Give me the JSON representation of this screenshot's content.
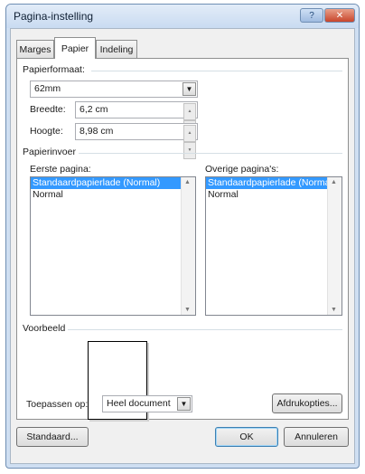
{
  "window": {
    "title": "Pagina-instelling",
    "help_label": "?",
    "close_label": "✕"
  },
  "tabs": [
    {
      "label": "Marges",
      "active": false
    },
    {
      "label": "Papier",
      "active": true
    },
    {
      "label": "Indeling",
      "active": false
    }
  ],
  "paper": {
    "format_group": "Papierformaat:",
    "format_value": "62mm",
    "width_label": "Breedte:",
    "width_value": "6,2 cm",
    "height_label": "Hoogte:",
    "height_value": "8,98 cm"
  },
  "source": {
    "group": "Papierinvoer",
    "first_page_label": "Eerste pagina:",
    "other_pages_label": "Overige pagina's:",
    "first_page_items": [
      "Standaardpapierlade (Normal)",
      "Normal"
    ],
    "other_pages_items": [
      "Standaardpapierlade (Normal)",
      "Normal"
    ]
  },
  "preview": {
    "group": "Voorbeeld",
    "apply_label": "Toepassen op:",
    "apply_value": "Heel document",
    "print_options_label": "Afdrukopties..."
  },
  "footer": {
    "default_label": "Standaard...",
    "ok_label": "OK",
    "cancel_label": "Annuleren"
  }
}
